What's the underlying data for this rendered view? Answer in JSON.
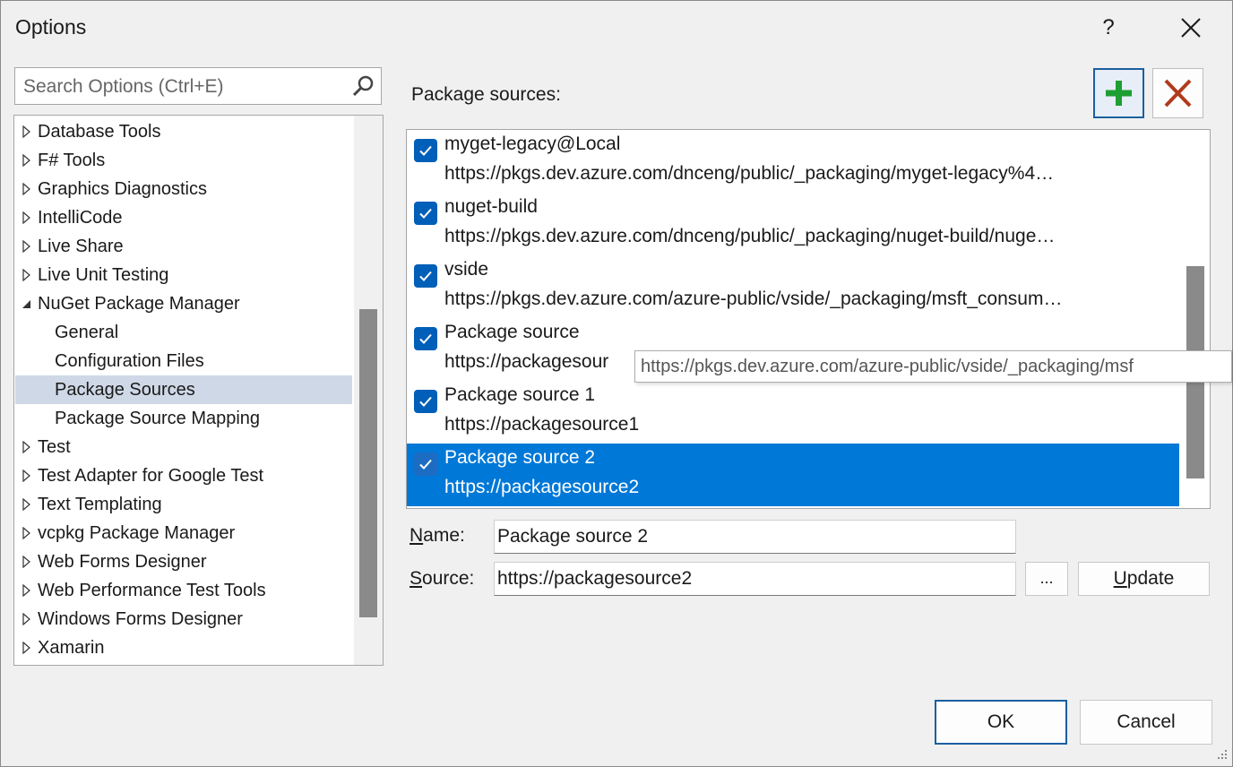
{
  "window": {
    "title": "Options",
    "help_label": "?"
  },
  "search": {
    "placeholder": "Search Options (Ctrl+E)"
  },
  "tree": {
    "items": [
      {
        "label": "Database Tools",
        "arrow": "collapsed"
      },
      {
        "label": "F# Tools",
        "arrow": "collapsed"
      },
      {
        "label": "Graphics Diagnostics",
        "arrow": "collapsed"
      },
      {
        "label": "IntelliCode",
        "arrow": "collapsed"
      },
      {
        "label": "Live Share",
        "arrow": "collapsed"
      },
      {
        "label": "Live Unit Testing",
        "arrow": "collapsed"
      },
      {
        "label": "NuGet Package Manager",
        "arrow": "expanded"
      },
      {
        "label": "General",
        "arrow": "none"
      },
      {
        "label": "Configuration Files",
        "arrow": "none"
      },
      {
        "label": "Package Sources",
        "arrow": "none",
        "selected": true
      },
      {
        "label": "Package Source Mapping",
        "arrow": "none"
      },
      {
        "label": "Test",
        "arrow": "collapsed"
      },
      {
        "label": "Test Adapter for Google Test",
        "arrow": "collapsed"
      },
      {
        "label": "Text Templating",
        "arrow": "collapsed"
      },
      {
        "label": "vcpkg Package Manager",
        "arrow": "collapsed"
      },
      {
        "label": "Web Forms Designer",
        "arrow": "collapsed"
      },
      {
        "label": "Web Performance Test Tools",
        "arrow": "collapsed"
      },
      {
        "label": "Windows Forms Designer",
        "arrow": "collapsed"
      },
      {
        "label": "Xamarin",
        "arrow": "collapsed"
      }
    ]
  },
  "package_sources": {
    "label": "Package sources:",
    "add_icon": "plus-icon",
    "remove_icon": "x-icon",
    "items": [
      {
        "name": "myget-legacy@Local",
        "url": "https://pkgs.dev.azure.com/dnceng/public/_packaging/myget-legacy%4…",
        "checked": true
      },
      {
        "name": "nuget-build",
        "url": "https://pkgs.dev.azure.com/dnceng/public/_packaging/nuget-build/nuge…",
        "checked": true
      },
      {
        "name": "vside",
        "url": "https://pkgs.dev.azure.com/azure-public/vside/_packaging/msft_consum…",
        "checked": true
      },
      {
        "name": "Package source",
        "url": "https://packagesour",
        "checked": true
      },
      {
        "name": "Package source 1",
        "url": "https://packagesource1",
        "checked": true
      },
      {
        "name": "Package source 2",
        "url": "https://packagesource2",
        "checked": true,
        "selected": true
      }
    ],
    "tooltip": "https://pkgs.dev.azure.com/azure-public/vside/_packaging/msf"
  },
  "form": {
    "name_label_accel": "N",
    "name_label_rest": "ame:",
    "name_value": "Package source 2",
    "source_label_accel": "S",
    "source_label_rest": "ource:",
    "source_value": "https://packagesource2",
    "browse_label": "...",
    "update_label_accel": "U",
    "update_label_rest": "pdate"
  },
  "footer": {
    "ok_label": "OK",
    "cancel_label": "Cancel"
  },
  "colors": {
    "selection": "#0078d7",
    "checkbox": "#005fb8",
    "add_green": "#1e9e33",
    "delete_red": "#b03a1c"
  }
}
